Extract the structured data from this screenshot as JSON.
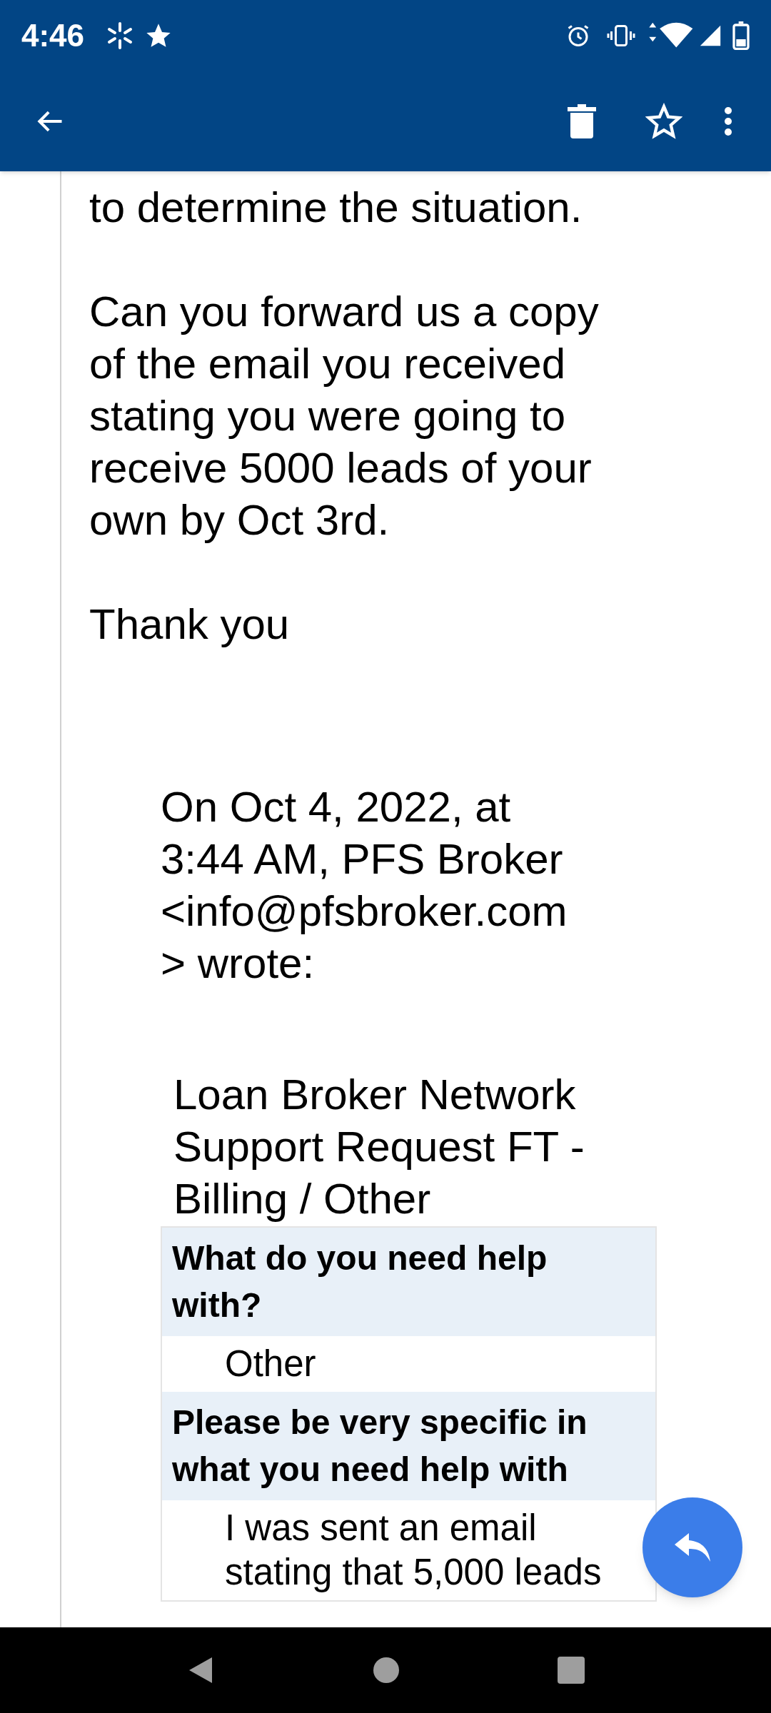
{
  "status_bar": {
    "time": "4:46"
  },
  "message": {
    "paragraphs": [
      {
        "lines": [
          "to determine the situation."
        ]
      },
      {
        "lines": [
          "Can you forward us a copy",
          "of the email you received",
          "stating you were going to",
          "receive 5000 leads of your",
          "own by Oct 3rd."
        ]
      },
      {
        "lines": [
          "Thank you"
        ]
      }
    ],
    "quote": {
      "attribution": [
        "On Oct 4, 2022, at",
        "3:44 AM, PFS Broker",
        "<info@pfsbroker.com",
        "> wrote:"
      ],
      "subject": [
        "Loan Broker Network",
        "Support Request FT -",
        "Billing / Other"
      ],
      "rows": [
        {
          "kind": "label",
          "lines": [
            "What do you need help",
            "with?"
          ]
        },
        {
          "kind": "value",
          "lines": [
            "Other"
          ]
        },
        {
          "kind": "label",
          "lines": [
            "Please be very specific in",
            "what you need help with"
          ]
        },
        {
          "kind": "value",
          "lines": [
            "I was sent an email",
            "stating that 5,000 leads"
          ]
        }
      ]
    }
  }
}
